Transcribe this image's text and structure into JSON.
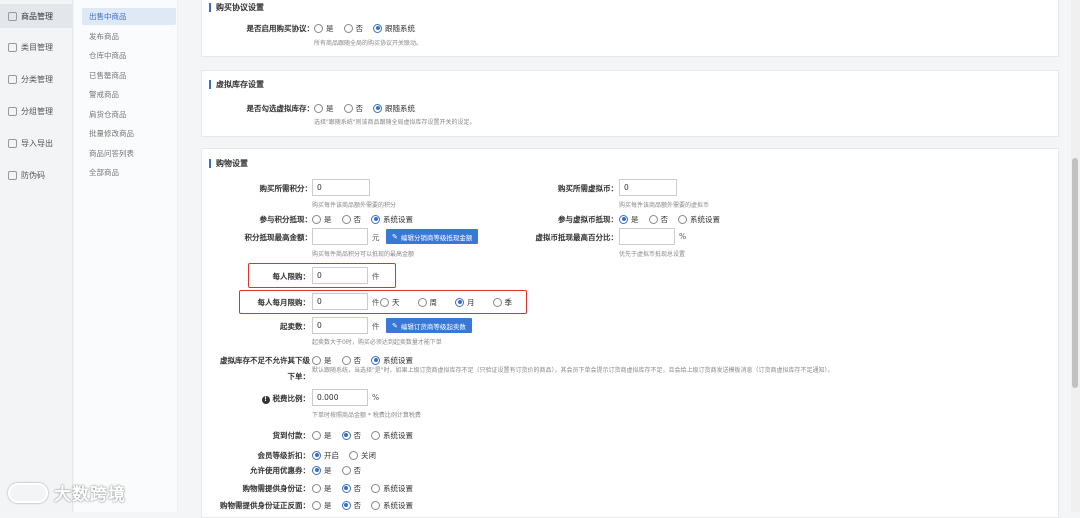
{
  "nav1": [
    "商品管理",
    "类目管理",
    "分类管理",
    "分组管理",
    "导入导出",
    "防伪码"
  ],
  "nav2": [
    "出售中商品",
    "发布商品",
    "仓库中商品",
    "已售罄商品",
    "警戒商品",
    "肩货仓商品",
    "批量修改商品",
    "商品问答列表",
    "全部商品"
  ],
  "buy_agree": {
    "title": "购买协议设置",
    "label": "是否启用购买协议：",
    "opts": [
      "是",
      "否",
      "跟随系统"
    ],
    "hint": "所有商品跟随全局的购买协议开关联动。"
  },
  "virtual": {
    "title": "虚拟库存设置",
    "label": "是否勾选虚拟库存：",
    "opts": [
      "是",
      "否",
      "跟随系统"
    ],
    "hint": "选择\"跟随系统\"则该商品跟随全局虚拟库存设置开关的设定。"
  },
  "shop": {
    "title": "购物设置",
    "points_label": "购买所需积分：",
    "points_val": "0",
    "points_hint": "购买每件该商品额外需要的积分",
    "vcoin_label": "购买所需虚拟币：",
    "vcoin_val": "0",
    "vcoin_hint": "购买每件该商品额外需要的虚拟币",
    "pdeduct_label": "参与积分抵现：",
    "pdeduct_opts": [
      "是",
      "否",
      "系统设置"
    ],
    "vdeduct_label": "参与虚拟币抵现：",
    "vdeduct_opts": [
      "是",
      "否",
      "系统设置"
    ],
    "pmax_label": "积分抵现最高金额：",
    "pmax_unit": "元",
    "pmax_btn": "编辑分销商等级抵现金额",
    "pmax_hint": "购买每件商品积分可以抵现的最高金额",
    "vmax_label": "虚拟币抵现最高百分比：",
    "vmax_unit": "%",
    "vmax_hint": "优先于虚拟币抵现总设置",
    "limit_label": "每人限购：",
    "limit_val": "0",
    "limit_unit": "件",
    "mlimit_label": "每人每月限购：",
    "mlimit_val": "0",
    "mlimit_unit": "件",
    "mlimit_opts": [
      "天",
      "周",
      "月",
      "季"
    ],
    "minsale_label": "起卖数：",
    "minsale_val": "0",
    "minsale_unit": "件",
    "minsale_btn": "编辑订货商等级起卖数",
    "minsale_hint": "起卖数大于0时，购买必须达到起卖数量才能下单",
    "vstock_label1": "虚拟库存不足不允许其下级",
    "vstock_label2": "下单：",
    "vstock_opts": [
      "是",
      "否",
      "系统设置"
    ],
    "vstock_hint": "默认跟随系统，当选择\"是\"时，如果上级订货商虚拟库存不足（只验证设置有订货价的商品），其会员下单会提示订货商虚拟库存不足，且会给上级订货商发送模板消息（订货商虚拟库存不足通知）。",
    "tax_label": "税费比例：",
    "tax_val": "0.000",
    "tax_unit": "%",
    "tax_hint": "下单时按照商品金额 * 税费比例计算税费",
    "cod_label": "货到付款：",
    "cod_opts": [
      "是",
      "否",
      "系统设置"
    ],
    "member_label": "会员等级折扣：",
    "member_opts": [
      "开启",
      "关闭"
    ],
    "coupon_label": "允许使用优惠券：",
    "coupon_opts": [
      "是",
      "否"
    ],
    "idcard_label": "购物需提供身份证：",
    "idcard_opts": [
      "是",
      "否",
      "系统设置"
    ],
    "idcard2_label": "购物需提供身份证正反面：",
    "idcard2_opts": [
      "是",
      "否",
      "系统设置"
    ]
  },
  "watermark": "大数跨境"
}
